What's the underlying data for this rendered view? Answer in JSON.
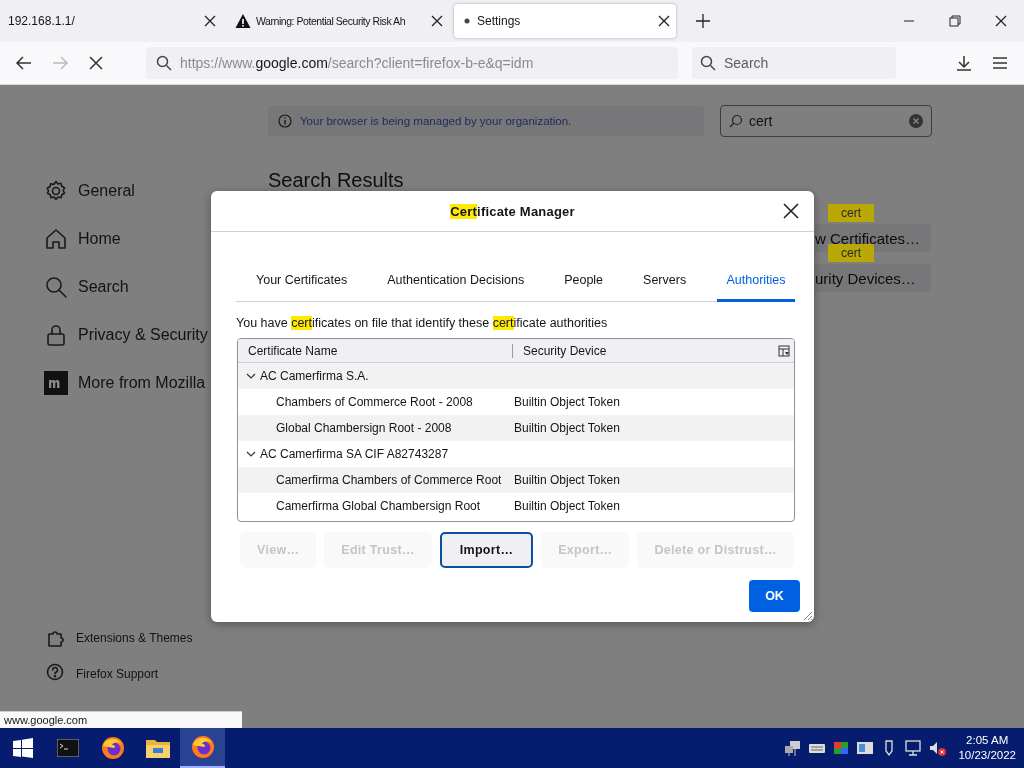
{
  "browser": {
    "tabs": [
      {
        "title": "192.168.1.1/",
        "selected": false
      },
      {
        "title": "Warning: Potential Security Risk Ah",
        "selected": false
      },
      {
        "title": "Settings",
        "selected": true
      }
    ],
    "address": [
      {
        "text": "https://www.",
        "strong": false
      },
      {
        "text": "google.com",
        "strong": true
      },
      {
        "text": "/search?client=firefox-b-e&q=idm",
        "strong": false
      }
    ],
    "search_placeholder": "Search"
  },
  "settings": {
    "notice": "Your browser is being managed by your organization.",
    "search": {
      "value": "cert"
    },
    "sidebar": {
      "items": [
        {
          "label": "General"
        },
        {
          "label": "Home"
        },
        {
          "label": "Search"
        },
        {
          "label": "Privacy & Security"
        },
        {
          "label": "More from Mozilla"
        }
      ],
      "footer_items": [
        {
          "label": "Extensions & Themes"
        },
        {
          "label": "Firefox Support"
        }
      ]
    },
    "heading": "Search Results",
    "result_buttons": [
      {
        "label": "w Certificates…",
        "tooltip": "cert"
      },
      {
        "label": "urity Devices…",
        "tooltip": "cert"
      }
    ]
  },
  "dialog": {
    "title": [
      {
        "text": "Cert",
        "highlighted": true
      },
      {
        "text": "ificate Manager",
        "highlighted": false
      }
    ],
    "tabs": [
      {
        "label": "Your Certificates",
        "selected": false
      },
      {
        "label": "Authentication Decisions",
        "selected": false
      },
      {
        "label": "People",
        "selected": false
      },
      {
        "label": "Servers",
        "selected": false
      },
      {
        "label": "Authorities",
        "selected": true
      }
    ],
    "description": [
      {
        "text": "You have ",
        "highlighted": false
      },
      {
        "text": "cert",
        "highlighted": true
      },
      {
        "text": "ificates on file that identify these ",
        "highlighted": false
      },
      {
        "text": "cert",
        "highlighted": true
      },
      {
        "text": "ificate authorities",
        "highlighted": false
      }
    ],
    "table": {
      "columns": [
        "Certificate Name",
        "Security Device"
      ],
      "rows": [
        {
          "name": "AC Camerfirma S.A.",
          "expanded": true,
          "children": [
            {
              "name": "Chambers of Commerce Root - 2008",
              "device": "Builtin Object Token"
            },
            {
              "name": "Global Chambersign Root - 2008",
              "device": "Builtin Object Token"
            }
          ]
        },
        {
          "name": "AC Camerfirma SA CIF A82743287",
          "expanded": true,
          "children": [
            {
              "name": "Camerfirma Chambers of Commerce Root",
              "device": "Builtin Object Token"
            },
            {
              "name": "Camerfirma Global Chambersign Root",
              "device": "Builtin Object Token"
            }
          ]
        }
      ]
    },
    "buttons": [
      {
        "label": "View…",
        "disabled": true,
        "focused": false
      },
      {
        "label": "Edit Trust…",
        "disabled": true,
        "focused": false
      },
      {
        "label": "Import…",
        "disabled": false,
        "focused": true
      },
      {
        "label": "Export…",
        "disabled": true,
        "focused": false
      },
      {
        "label": "Delete or Distrust…",
        "disabled": true,
        "focused": false
      }
    ],
    "ok_button": "OK"
  },
  "status_text": "www.google.com",
  "taskbar": {
    "apps": [
      {
        "kind": "start",
        "selected": false
      },
      {
        "kind": "terminal",
        "selected": false
      },
      {
        "kind": "firefox",
        "selected": false
      },
      {
        "kind": "folder",
        "selected": false
      },
      {
        "kind": "firefox",
        "selected": true
      }
    ],
    "clock": {
      "time": "2:05 AM",
      "date": "10/23/2022"
    }
  }
}
